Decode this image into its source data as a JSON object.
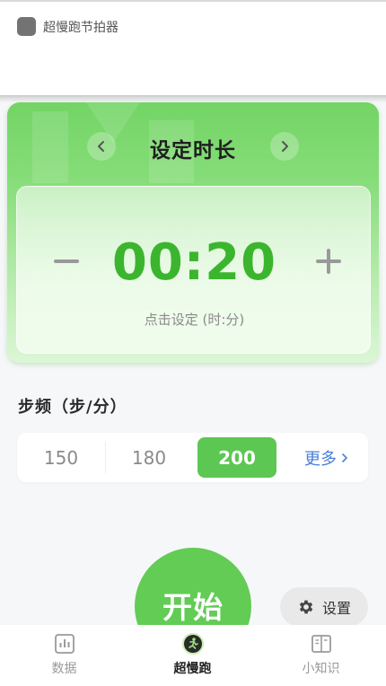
{
  "app": {
    "title": "超慢跑节拍器"
  },
  "timer": {
    "title": "设定时长",
    "value": "00:20",
    "hint": "点击设定 (时:分)"
  },
  "cadence": {
    "label": "步频（步/分）",
    "options": [
      "150",
      "180",
      "200"
    ],
    "selected": "200",
    "more_label": "更多"
  },
  "actions": {
    "start_label": "开始",
    "settings_label": "设置"
  },
  "bottom_nav": [
    {
      "label": "数据",
      "icon": "chart-icon"
    },
    {
      "label": "超慢跑",
      "icon": "runner-icon",
      "active": true
    },
    {
      "label": "小知识",
      "icon": "book-icon"
    }
  ],
  "colors": {
    "accent_green": "#5cc752",
    "time_green": "#3cb52e",
    "link_blue": "#4a7fd6"
  }
}
